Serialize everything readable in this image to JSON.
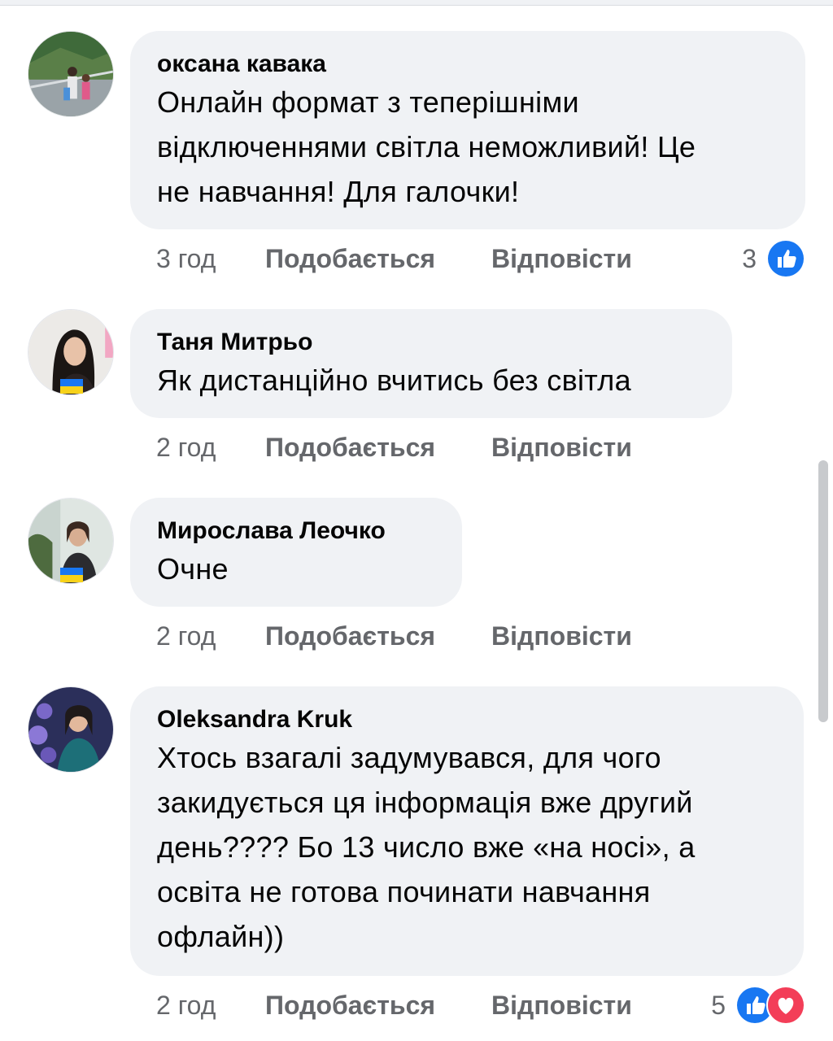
{
  "comments": [
    {
      "author": "оксана кавака",
      "text_lines": [
        "Онлайн формат з теперішніми",
        "відключеннями світла неможливий! Це",
        "не навчання! Для галочки!"
      ],
      "time": "3 год",
      "like_label": "Подобається",
      "reply_label": "Відповісти",
      "reaction_count": "3",
      "reactions": [
        "like-icon"
      ],
      "avatar_flag": false
    },
    {
      "author": "Таня Митрьо",
      "text_lines": [
        "Як дистанційно вчитись без світла"
      ],
      "time": "2 год",
      "like_label": "Подобається",
      "reply_label": "Відповісти",
      "reaction_count": "",
      "reactions": [],
      "avatar_flag": true
    },
    {
      "author": "Мирослава Леочко",
      "text_lines": [
        "Очне"
      ],
      "time": "2 год",
      "like_label": "Подобається",
      "reply_label": "Відповісти",
      "reaction_count": "",
      "reactions": [],
      "avatar_flag": true
    },
    {
      "author": "Oleksandra Kruk",
      "text_lines": [
        "Хтось взагалі задумувався, для чого",
        "закидується ця інформація вже другий",
        "день???? Бо 13 число вже «на носі», а",
        "освіта не готова починати навчання",
        "офлайн))"
      ],
      "time": "2 год",
      "like_label": "Подобається",
      "reply_label": "Відповісти",
      "reaction_count": "5",
      "reactions": [
        "like-icon",
        "love-icon"
      ],
      "avatar_flag": false
    }
  ],
  "colors": {
    "bubble": "#f0f2f5",
    "meta_text": "#65676b",
    "like_blue": "#1877f2",
    "love_red": "#f33e58",
    "flag_blue": "#1877f2",
    "flag_yellow": "#f7d21a"
  }
}
